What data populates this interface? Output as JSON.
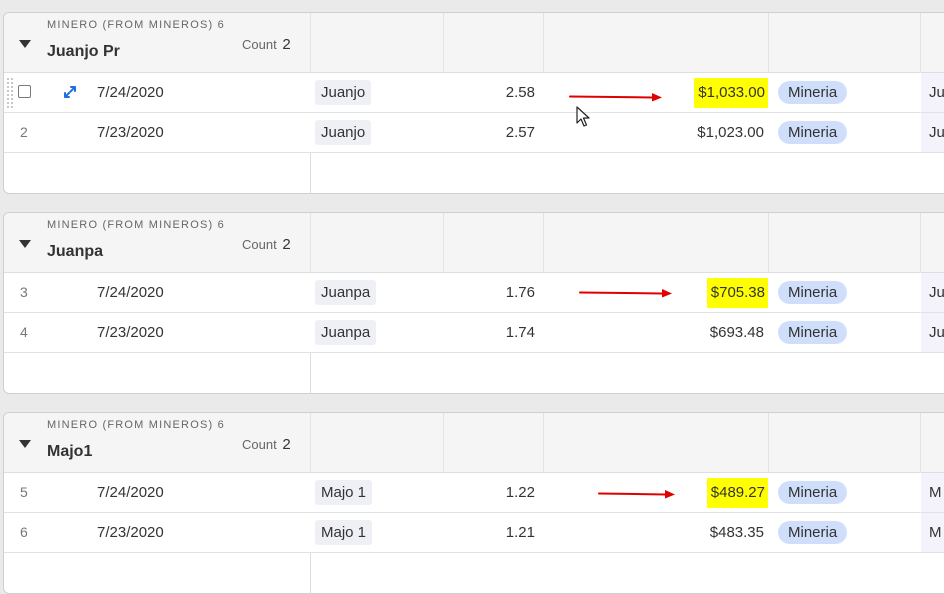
{
  "groups": [
    {
      "label": "MINERO (FROM MINEROS) 6",
      "name": "Juanjo Pr",
      "count_label": "Count",
      "count": "2",
      "rows": [
        {
          "num": "",
          "date": "7/24/2020",
          "name": "Juanjo",
          "value": "2.58",
          "amount": "$1,033.00",
          "highlight": true,
          "tag": "Mineria",
          "tail": "Ju"
        },
        {
          "num": "2",
          "date": "7/23/2020",
          "name": "Juanjo",
          "value": "2.57",
          "amount": "$1,023.00",
          "highlight": false,
          "tag": "Mineria",
          "tail": "Ju"
        }
      ]
    },
    {
      "label": "MINERO (FROM MINEROS) 6",
      "name": "Juanpa",
      "count_label": "Count",
      "count": "2",
      "rows": [
        {
          "num": "3",
          "date": "7/24/2020",
          "name": "Juanpa",
          "value": "1.76",
          "amount": "$705.38",
          "highlight": true,
          "tag": "Mineria",
          "tail": "Ju"
        },
        {
          "num": "4",
          "date": "7/23/2020",
          "name": "Juanpa",
          "value": "1.74",
          "amount": "$693.48",
          "highlight": false,
          "tag": "Mineria",
          "tail": "Ju"
        }
      ]
    },
    {
      "label": "MINERO (FROM MINEROS) 6",
      "name": "Majo1",
      "count_label": "Count",
      "count": "2",
      "rows": [
        {
          "num": "5",
          "date": "7/24/2020",
          "name": "Majo 1",
          "value": "1.22",
          "amount": "$489.27",
          "highlight": true,
          "tag": "Mineria",
          "tail": "M"
        },
        {
          "num": "6",
          "date": "7/23/2020",
          "name": "Majo 1",
          "value": "1.21",
          "amount": "$483.35",
          "highlight": false,
          "tag": "Mineria",
          "tail": "M"
        }
      ]
    }
  ],
  "colors": {
    "highlight": "#ffff00",
    "tag_bg": "#cfdffb",
    "annotation_arrow": "#e00000",
    "expand_icon": "#1f6fe0"
  },
  "icons": [
    "collapse-caret-icon",
    "expand-record-icon",
    "row-checkbox",
    "drag-handle-icon",
    "mouse-cursor-icon",
    "annotation-arrow-icon"
  ]
}
